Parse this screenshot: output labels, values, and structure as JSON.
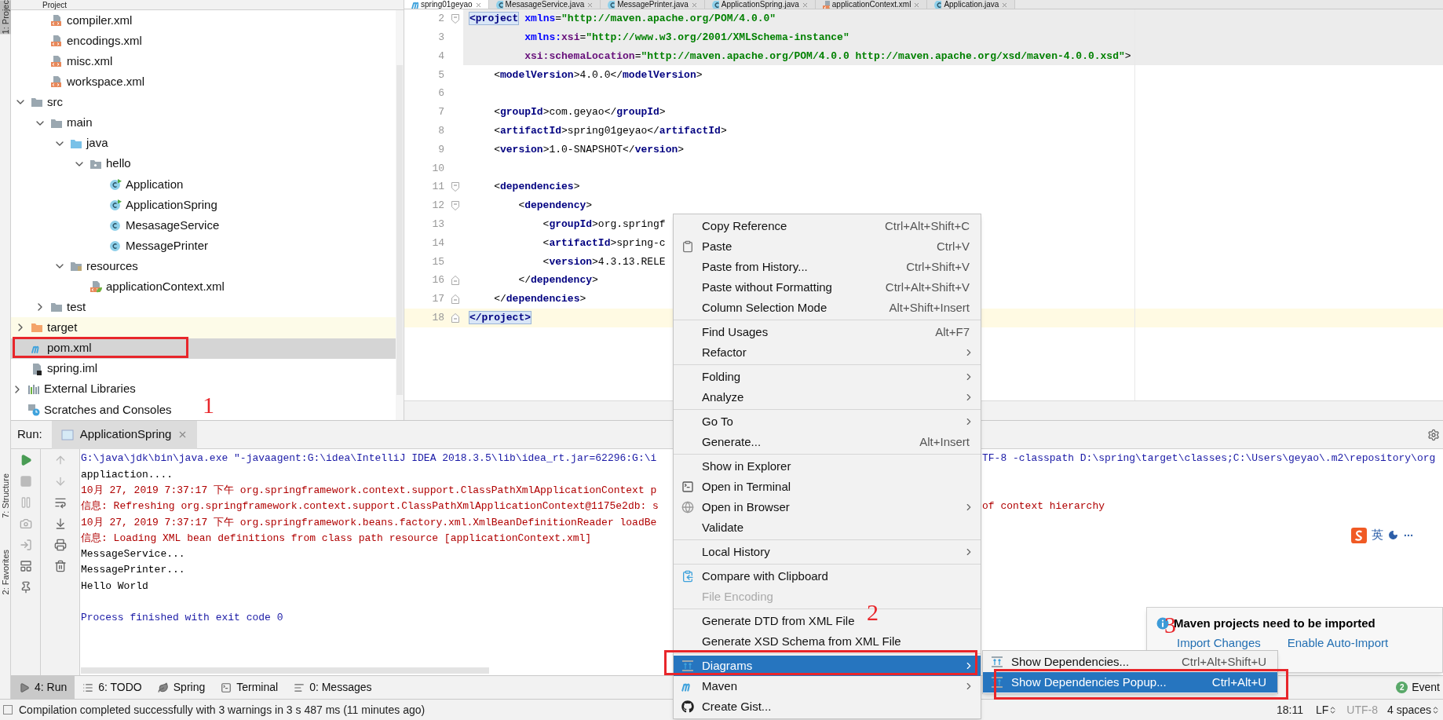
{
  "side_tabs": [
    {
      "label": "1: Projec",
      "selected": true
    },
    {
      "label": "7: Structure",
      "selected": false
    },
    {
      "label": "2: Favorites",
      "selected": false
    }
  ],
  "project_panel": {
    "title": "Project",
    "tree": [
      {
        "children": [
          {
            "children": [
              {
                "label": "compiler.xml",
                "kind": "xml",
                "selected": false
              },
              {
                "label": "encodings.xml",
                "kind": "xml",
                "selected": false
              },
              {
                "label": "misc.xml",
                "kind": "xml",
                "selected": false
              },
              {
                "label": "workspace.xml",
                "kind": "xml",
                "selected": false
              }
            ]
          },
          {
            "label": "src",
            "kind": "folder",
            "selected": false,
            "expanded": true,
            "children": [
              {
                "label": "main",
                "kind": "folder",
                "selected": false,
                "expanded": true,
                "children": [
                  {
                    "label": "java",
                    "kind": "source_folder",
                    "selected": false,
                    "expanded": true,
                    "children": [
                      {
                        "label": "hello",
                        "kind": "package",
                        "selected": false,
                        "expanded": true,
                        "children": [
                          {
                            "label": "Application",
                            "kind": "class_main",
                            "selected": false
                          },
                          {
                            "label": "ApplicationSpring",
                            "kind": "class_main",
                            "selected": false
                          },
                          {
                            "label": "MesasageService",
                            "kind": "class",
                            "selected": false
                          },
                          {
                            "label": "MessagePrinter",
                            "kind": "class",
                            "selected": false
                          }
                        ]
                      }
                    ]
                  },
                  {
                    "label": "resources",
                    "kind": "resource_folder",
                    "selected": false,
                    "expanded": true,
                    "children": [
                      {
                        "label": "applicationContext.xml",
                        "kind": "spring_xml",
                        "selected": false
                      }
                    ]
                  }
                ]
              },
              {
                "label": "test",
                "kind": "folder",
                "selected": false,
                "expanded": false
              }
            ]
          },
          {
            "label": "target",
            "kind": "excluded_folder",
            "selected": false,
            "expanded": false
          },
          {
            "label": "pom.xml",
            "kind": "maven",
            "selected": true
          },
          {
            "label": "spring.iml",
            "kind": "iml",
            "selected": false
          }
        ]
      },
      {
        "label": "External Libraries",
        "kind": "libraries",
        "selected": false,
        "expanded": false
      },
      {
        "label": "Scratches and Consoles",
        "kind": "scratches",
        "selected": false
      }
    ]
  },
  "editor_tabs": [
    {
      "label": "spring01geyao",
      "kind": "maven",
      "selected": true
    },
    {
      "label": "MesasageService.java",
      "kind": "class",
      "selected": false
    },
    {
      "label": "MessagePrinter.java",
      "kind": "class",
      "selected": false
    },
    {
      "label": "ApplicationSpring.java",
      "kind": "class",
      "selected": false
    },
    {
      "label": "applicationContext.xml",
      "kind": "spring_xml",
      "selected": false
    },
    {
      "label": "Application.java",
      "kind": "class",
      "selected": false
    }
  ],
  "editor_lines": [
    {
      "number": "2",
      "kind": "fold_start",
      "highlighted": true,
      "current": false,
      "code": [
        {
          "kind": "match",
          "text": "<project"
        },
        {
          "kind": "attr",
          "text": " xmlns"
        },
        {
          "kind": "text",
          "text": "="
        },
        {
          "kind": "value",
          "text": "\"http://maven.apache.org/POM/4.0.0\""
        }
      ]
    },
    {
      "number": "3",
      "highlighted": true,
      "current": false,
      "code": [
        {
          "kind": "attr",
          "text": "         xmlns:"
        },
        {
          "kind": "ns",
          "text": "xsi"
        },
        {
          "kind": "text",
          "text": "="
        },
        {
          "kind": "value",
          "text": "\"http://www.w3.org/2001/XMLSchema-instance\""
        }
      ]
    },
    {
      "number": "4",
      "highlighted": true,
      "current": false,
      "code": [
        {
          "kind": "ns",
          "text": "         xsi:schemaLocation"
        },
        {
          "kind": "text",
          "text": "="
        },
        {
          "kind": "value",
          "text": "\"http://maven.apache.org/POM/4.0.0 http://maven.apache.org/xsd/maven-4.0.0.xsd\""
        },
        {
          "kind": "text",
          "text": ">"
        }
      ]
    },
    {
      "number": "5",
      "highlighted": false,
      "current": false,
      "code": [
        {
          "kind": "text",
          "text": "    <"
        },
        {
          "kind": "tag",
          "text": "modelVersion"
        },
        {
          "kind": "text",
          "text": ">4.0.0</"
        },
        {
          "kind": "tag",
          "text": "modelVersion"
        },
        {
          "kind": "text",
          "text": ">"
        }
      ]
    },
    {
      "number": "6",
      "highlighted": false,
      "current": false
    },
    {
      "number": "7",
      "highlighted": false,
      "current": false,
      "code": [
        {
          "kind": "text",
          "text": "    <"
        },
        {
          "kind": "tag",
          "text": "groupId"
        },
        {
          "kind": "text",
          "text": ">com.geyao</"
        },
        {
          "kind": "tag",
          "text": "groupId"
        },
        {
          "kind": "text",
          "text": ">"
        }
      ]
    },
    {
      "number": "8",
      "highlighted": false,
      "current": false,
      "code": [
        {
          "kind": "text",
          "text": "    <"
        },
        {
          "kind": "tag",
          "text": "artifactId"
        },
        {
          "kind": "text",
          "text": ">spring01geyao</"
        },
        {
          "kind": "tag",
          "text": "artifactId"
        },
        {
          "kind": "text",
          "text": ">"
        }
      ]
    },
    {
      "number": "9",
      "highlighted": false,
      "current": false,
      "code": [
        {
          "kind": "text",
          "text": "    <"
        },
        {
          "kind": "tag",
          "text": "version"
        },
        {
          "kind": "text",
          "text": ">1.0-SNAPSHOT</"
        },
        {
          "kind": "tag",
          "text": "version"
        },
        {
          "kind": "text",
          "text": ">"
        }
      ]
    },
    {
      "number": "10",
      "highlighted": false,
      "current": false
    },
    {
      "number": "11",
      "kind": "fold_start",
      "highlighted": false,
      "current": false,
      "code": [
        {
          "kind": "text",
          "text": "    <"
        },
        {
          "kind": "tag",
          "text": "dependencies"
        },
        {
          "kind": "text",
          "text": ">"
        }
      ]
    },
    {
      "number": "12",
      "kind": "fold_start",
      "highlighted": false,
      "current": false,
      "code": [
        {
          "kind": "text",
          "text": "        <"
        },
        {
          "kind": "tag",
          "text": "dependency"
        },
        {
          "kind": "text",
          "text": ">"
        }
      ]
    },
    {
      "number": "13",
      "highlighted": false,
      "current": false,
      "code": [
        {
          "kind": "text",
          "text": "            <"
        },
        {
          "kind": "tag",
          "text": "groupId"
        },
        {
          "kind": "text",
          "text": ">org.springf"
        }
      ]
    },
    {
      "number": "14",
      "highlighted": false,
      "current": false,
      "code": [
        {
          "kind": "text",
          "text": "            <"
        },
        {
          "kind": "tag",
          "text": "artifactId"
        },
        {
          "kind": "text",
          "text": ">spring-c"
        }
      ]
    },
    {
      "number": "15",
      "highlighted": false,
      "current": false,
      "code": [
        {
          "kind": "text",
          "text": "            <"
        },
        {
          "kind": "tag",
          "text": "version"
        },
        {
          "kind": "text",
          "text": ">4.3.13.RELE"
        }
      ]
    },
    {
      "number": "16",
      "kind": "fold_end",
      "highlighted": false,
      "current": false,
      "code": [
        {
          "kind": "text",
          "text": "        </"
        },
        {
          "kind": "tag",
          "text": "dependency"
        },
        {
          "kind": "text",
          "text": ">"
        }
      ]
    },
    {
      "number": "17",
      "kind": "fold_end",
      "highlighted": false,
      "current": false,
      "code": [
        {
          "kind": "text",
          "text": "    </"
        },
        {
          "kind": "tag",
          "text": "dependencies"
        },
        {
          "kind": "text",
          "text": ">"
        }
      ]
    },
    {
      "number": "18",
      "kind": "fold_end",
      "highlighted": false,
      "current": true,
      "code": [
        {
          "kind": "match",
          "text": "</project>"
        }
      ]
    }
  ],
  "run_panel": {
    "label": "Run:",
    "tab": "ApplicationSpring",
    "console": [
      {
        "kind": "command",
        "text": "G:\\java\\jdk\\bin\\java.exe \"-javaagent:G:\\idea\\IntelliJ IDEA 2018.3.5\\lib\\idea_rt.jar=62296:G:\\i",
        "text_right": "TF-8 -classpath D:\\spring\\target\\classes;C:\\Users\\geyao\\.m2\\repository\\org"
      },
      {
        "kind": "stdout",
        "text": "appliaction...."
      },
      {
        "kind": "stderr",
        "text": "10月 27, 2019 7:37:17 下午 org.springframework.context.support.ClassPathXmlApplicationContext p"
      },
      {
        "kind": "stderr",
        "text": "信息: Refreshing org.springframework.context.support.ClassPathXmlApplicationContext@1175e2db: s",
        "text_right": "of context hierarchy"
      },
      {
        "kind": "stderr",
        "text": "10月 27, 2019 7:37:17 下午 org.springframework.beans.factory.xml.XmlBeanDefinitionReader loadBe"
      },
      {
        "kind": "stderr",
        "text": "信息: Loading XML bean definitions from class path resource [applicationContext.xml]"
      },
      {
        "kind": "stdout",
        "text": "MessageService..."
      },
      {
        "kind": "stdout",
        "text": "MessagePrinter..."
      },
      {
        "kind": "stdout",
        "text": "Hello World"
      },
      {
        "kind": "blank"
      },
      {
        "kind": "command",
        "text": "Process finished with exit code 0"
      }
    ]
  },
  "tool_tabs": [
    {
      "label": "4: Run",
      "kind": "run",
      "selected": true
    },
    {
      "label": "6: TODO",
      "kind": "todo",
      "selected": false
    },
    {
      "label": "Spring",
      "kind": "spring",
      "selected": false
    },
    {
      "label": "Terminal",
      "kind": "terminal",
      "selected": false
    },
    {
      "label": "0: Messages",
      "kind": "messages",
      "selected": false
    }
  ],
  "event_log": {
    "badge": "2",
    "label": "Event"
  },
  "status_bar": {
    "message": "Compilation completed successfully with 3 warnings in 3 s 487 ms (11 minutes ago)",
    "position": "18:11",
    "line_separator": "LF",
    "encoding": "UTF-8",
    "indent": "4 spaces"
  },
  "context_menu": [
    [
      {
        "label": "Copy Reference",
        "shortcut": "Ctrl+Alt+Shift+C",
        "submenu": false,
        "disabled": false,
        "selected": false
      },
      {
        "label": "Paste",
        "shortcut": "Ctrl+V",
        "kind": "clipboard",
        "submenu": false,
        "disabled": false,
        "selected": false
      },
      {
        "label": "Paste from History...",
        "shortcut": "Ctrl+Shift+V",
        "submenu": false,
        "disabled": false,
        "selected": false
      },
      {
        "label": "Paste without Formatting",
        "shortcut": "Ctrl+Alt+Shift+V",
        "submenu": false,
        "disabled": false,
        "selected": false
      },
      {
        "label": "Column Selection Mode",
        "shortcut": "Alt+Shift+Insert",
        "submenu": false,
        "disabled": false,
        "selected": false
      }
    ],
    [
      {
        "label": "Find Usages",
        "shortcut": "Alt+F7",
        "submenu": false,
        "disabled": false,
        "selected": false
      },
      {
        "label": "Refactor",
        "submenu": true,
        "disabled": false,
        "selected": false
      }
    ],
    [
      {
        "label": "Folding",
        "submenu": true,
        "disabled": false,
        "selected": false
      },
      {
        "label": "Analyze",
        "submenu": true,
        "disabled": false,
        "selected": false
      }
    ],
    [
      {
        "label": "Go To",
        "submenu": true,
        "disabled": false,
        "selected": false
      },
      {
        "label": "Generate...",
        "shortcut": "Alt+Insert",
        "submenu": false,
        "disabled": false,
        "selected": false
      }
    ],
    [
      {
        "label": "Show in Explorer",
        "submenu": false,
        "disabled": false,
        "selected": false
      },
      {
        "label": "Open in Terminal",
        "kind": "terminal",
        "submenu": false,
        "disabled": false,
        "selected": false
      },
      {
        "label": "Open in Browser",
        "kind": "browser",
        "submenu": true,
        "disabled": false,
        "selected": false
      },
      {
        "label": "Validate",
        "submenu": false,
        "disabled": false,
        "selected": false
      }
    ],
    [
      {
        "label": "Local History",
        "submenu": true,
        "disabled": false,
        "selected": false
      }
    ],
    [
      {
        "label": "Compare with Clipboard",
        "kind": "compare",
        "submenu": false,
        "disabled": false,
        "selected": false
      },
      {
        "label": "File Encoding",
        "submenu": false,
        "disabled": true,
        "selected": false
      }
    ],
    [
      {
        "label": "Generate DTD from XML File",
        "submenu": false,
        "disabled": false,
        "selected": false
      },
      {
        "label": "Generate XSD Schema from XML File",
        "submenu": false,
        "disabled": false,
        "selected": false
      }
    ],
    [
      {
        "label": "Diagrams",
        "kind": "diagram",
        "submenu": true,
        "disabled": false,
        "selected": true
      },
      {
        "label": "Maven",
        "kind": "maven",
        "submenu": true,
        "disabled": false,
        "selected": false
      },
      {
        "label": "Create Gist...",
        "kind": "github",
        "submenu": false,
        "disabled": false,
        "selected": false
      }
    ]
  ],
  "submenu": [
    {
      "label": "Show Dependencies...",
      "shortcut": "Ctrl+Alt+Shift+U",
      "selected": false
    },
    {
      "label": "Show Dependencies Popup...",
      "shortcut": "Ctrl+Alt+U",
      "selected": true
    }
  ],
  "notification": {
    "title": "Maven projects need to be imported",
    "links": [
      "Import Changes",
      "Enable Auto-Import"
    ]
  },
  "ime_bar": {
    "label": "英"
  },
  "annotations": [
    {
      "label": "1"
    },
    {
      "label": "2"
    },
    {
      "label": "3"
    }
  ]
}
